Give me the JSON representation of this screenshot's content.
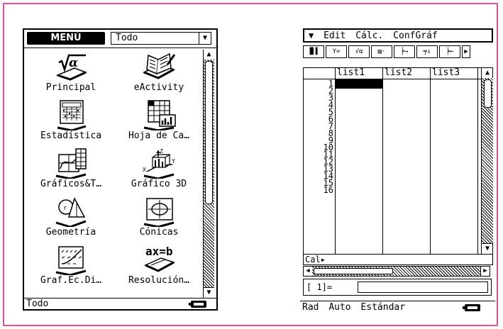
{
  "menu_screen": {
    "menu_label": "MENÚ",
    "category_value": "Todo",
    "apps": [
      {
        "label": "Principal",
        "icon": "sqrt-alpha-icon"
      },
      {
        "label": "eActivity",
        "icon": "open-book-icon"
      },
      {
        "label": "Estadística",
        "icon": "statistics-icon"
      },
      {
        "label": "Hoja de Ca…",
        "icon": "spreadsheet-icon"
      },
      {
        "label": "Gráficos&T…",
        "icon": "graph-table-icon"
      },
      {
        "label": "Gráfico 3D",
        "icon": "graph-3d-icon"
      },
      {
        "label": "Geometría",
        "icon": "geometry-icon"
      },
      {
        "label": "Cónicas",
        "icon": "conics-icon"
      },
      {
        "label": "Graf.Ec.Di…",
        "icon": "diff-eq-graph-icon"
      },
      {
        "label": "Resolución…",
        "icon": "equation-solver-icon"
      }
    ],
    "status_text": "Todo"
  },
  "sheet_screen": {
    "menu_items": [
      "Edit",
      "Cálc.",
      "ConfGráf"
    ],
    "columns": [
      "list1",
      "list2",
      "list3"
    ],
    "row_numbers": [
      "1",
      "2",
      "3",
      "4",
      "5",
      "6",
      "7",
      "8",
      "9",
      "10",
      "11",
      "12",
      "13",
      "14",
      "15",
      "16"
    ],
    "calc_row_label": "Cal▸",
    "entry_ref": "[    1]=",
    "status": [
      "Rad",
      "Auto",
      "Estándar"
    ]
  }
}
